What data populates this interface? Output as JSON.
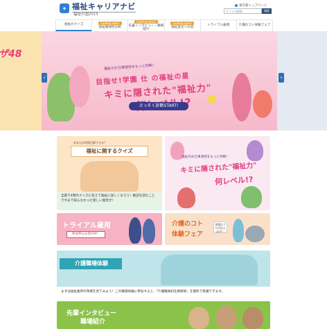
{
  "header": {
    "logo_title": "福祉キャリアナビ",
    "logo_sub": "福祉の国2015",
    "top_link": "東京都トップページ",
    "search_placeholder": "サイト内検索",
    "search_button": "検索"
  },
  "nav": {
    "soon_label": "Coming soon!",
    "items": [
      {
        "label": "福祉のクイズ",
        "soon": false
      },
      {
        "label": "福祉職適性診断",
        "soon": true
      },
      {
        "label": "先輩インタビュー・職場紹介",
        "soon": true
      },
      {
        "label": "福祉就活への道",
        "soon": true
      },
      {
        "label": "トライアル雇用",
        "soon": false
      },
      {
        "label": "介護のコト体験フェア",
        "soon": false
      }
    ]
  },
  "hero": {
    "left_text": "ザ48",
    "pre": "福祉のお仕事適性をもっと判断！",
    "title1": "目指せ!学園 仕 の福祉の星",
    "title2": "キミに隠された\"福祉力\"",
    "title3": "何レベル!?",
    "start": "さっそく診断START!",
    "prev_arrow": "‹",
    "next_arrow": "›"
  },
  "cards": {
    "quiz": {
      "tag": "あなたは何問正解できる？",
      "title": "福祉に関するクイズ",
      "desc": "全部で4問のクイズに答えて福祉に詳しくなろう！解説を読むことで今まで知らなかった新しい発見が！"
    },
    "quiz2": {
      "pre": "福祉のお仕事適性をもっと判断！",
      "t1": "キミに隠された\"福祉力\"",
      "t2": "何レベル!?"
    },
    "trial": {
      "title": "トライアル雇用",
      "badge": "参加申込み受付中！"
    },
    "fair": {
      "t1": "介護のコト",
      "t2": "体験フェア",
      "note": "現場のプロが伝えます！"
    },
    "kaigo": {
      "title": "介護職場体験",
      "desc": "まずは福祉業界の現場を見てみよう！この職場体験に参加すると、「介護職員初任者研修」を無料で受講できます。"
    },
    "senpai": {
      "t1": "先輩インタビュー",
      "t2": "職場紹介"
    }
  },
  "colors": {
    "accent": "#2e7fd1",
    "hero_bg": "#f6b9cc",
    "pink_title": "#e23c7d",
    "teal": "#2fa4b5",
    "green": "#8bc34a"
  }
}
